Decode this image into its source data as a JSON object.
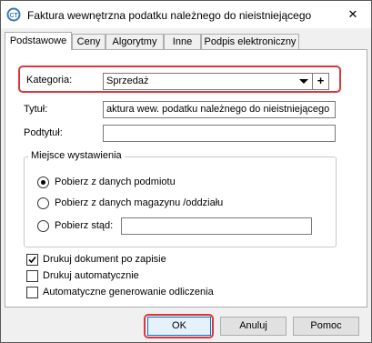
{
  "window": {
    "title": "Faktura wewnętrzna podatku należnego do nieistniejącego",
    "close_glyph": "✕"
  },
  "tabs": [
    {
      "label": "Podstawowe",
      "active": true
    },
    {
      "label": "Ceny",
      "active": false
    },
    {
      "label": "Algorytmy",
      "active": false
    },
    {
      "label": "Inne",
      "active": false
    },
    {
      "label": "Podpis elektroniczny",
      "active": false
    }
  ],
  "form": {
    "kategoria_label": "Kategoria:",
    "kategoria_value": "Sprzedaż",
    "add_button": "+",
    "tytul_label": "Tytuł:",
    "tytul_value": "aktura wew. podatku należnego do nieistniejącego",
    "podtytul_label": "Podtytuł:",
    "podtytul_value": ""
  },
  "miejsce": {
    "title": "Miejsce wystawienia",
    "options": [
      {
        "label": "Pobierz z danych podmiotu",
        "selected": true
      },
      {
        "label": "Pobierz z danych magazynu /oddziału",
        "selected": false
      },
      {
        "label": "Pobierz stąd:",
        "selected": false
      }
    ],
    "stad_value": ""
  },
  "checkboxes": [
    {
      "label": "Drukuj dokument po zapisie",
      "checked": true
    },
    {
      "label": "Drukuj automatycznie",
      "checked": false
    },
    {
      "label": "Automatyczne generowanie odliczenia",
      "checked": false
    }
  ],
  "buttons": {
    "ok": "OK",
    "cancel": "Anuluj",
    "help": "Pomoc"
  },
  "colors": {
    "highlight": "#e0353b",
    "window_bg": "#f0f0f0"
  }
}
